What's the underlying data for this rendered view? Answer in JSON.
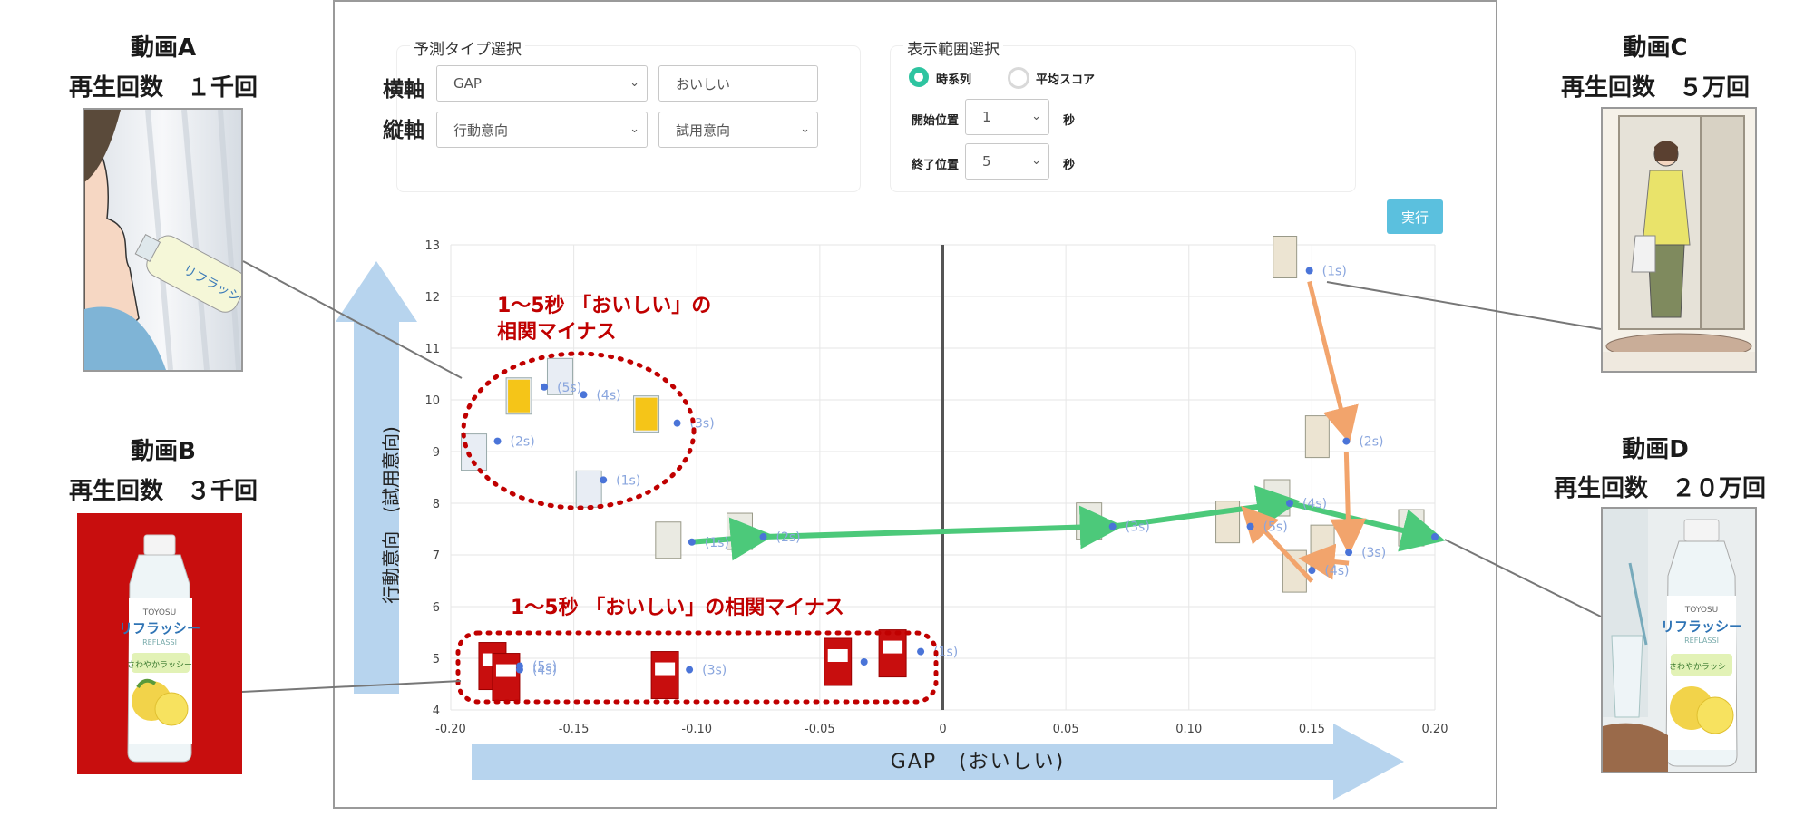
{
  "videos": {
    "a": {
      "title": "動画A",
      "plays": "再生回数　１千回"
    },
    "b": {
      "title": "動画B",
      "plays": "再生回数　３千回"
    },
    "c": {
      "title": "動画C",
      "plays": "再生回数　５万回"
    },
    "d": {
      "title": "動画D",
      "plays": "再生回数　２０万回"
    }
  },
  "form": {
    "predict_title": "予測タイプ選択",
    "x_label": "横軸",
    "y_label": "縦軸",
    "x_select": "GAP",
    "x_sub_select": "おいしい",
    "y_select": "行動意向",
    "y_sub_select": "試用意向",
    "range_title": "表示範囲選択",
    "radio_timeseries": "時系列",
    "radio_avg": "平均スコア",
    "start_label": "開始位置",
    "start_value": "1",
    "end_label": "終了位置",
    "end_value": "5",
    "unit_sec": "秒",
    "run_button": "実行"
  },
  "annotations": {
    "upper_line1": "1〜5秒 「おいしい」の",
    "upper_line2": "相関マイナス",
    "lower": "1〜5秒 「おいしい」の相関マイナス"
  },
  "colors": {
    "point": "#4a74d8",
    "point_label": "#8aa6de",
    "green_arrow": "#4cc97a",
    "orange_arrow": "#f2a46c",
    "annotation_red": "#c00000",
    "axis_arrow": "#b7d4ee",
    "bottle_red": "#c80e0e"
  },
  "chart_data": {
    "type": "scatter",
    "xlabel": "GAP　(おいしい)",
    "ylabel": "行動意向　(試用意向)",
    "xlim": [
      -0.2,
      0.2
    ],
    "ylim": [
      4,
      13
    ],
    "xticks": [
      -0.2,
      -0.15,
      -0.1,
      -0.05,
      0,
      0.05,
      0.1,
      0.15,
      0.2
    ],
    "xtick_labels": [
      "-0.20",
      "-0.15",
      "-0.10",
      "-0.05",
      "0",
      "0.05",
      "0.10",
      "0.15",
      "0.20"
    ],
    "yticks": [
      4,
      5,
      6,
      7,
      8,
      9,
      10,
      11,
      12,
      13
    ],
    "ytick_labels": [
      "4",
      "5",
      "6",
      "7",
      "8",
      "9",
      "10",
      "11",
      "12",
      "13"
    ],
    "grid": true,
    "series": [
      {
        "name": "動画A",
        "points": [
          {
            "x": -0.138,
            "y": 8.45,
            "label": "(1s)"
          },
          {
            "x": -0.181,
            "y": 9.2,
            "label": "(2s)"
          },
          {
            "x": -0.108,
            "y": 9.55,
            "label": "(3s)"
          },
          {
            "x": -0.146,
            "y": 10.1,
            "label": "(4s)"
          },
          {
            "x": -0.162,
            "y": 10.25,
            "label": "(5s)"
          }
        ]
      },
      {
        "name": "動画B",
        "points": [
          {
            "x": -0.172,
            "y": 4.78,
            "label": "(4s)"
          },
          {
            "x": -0.172,
            "y": 4.85,
            "label": "(5s)"
          },
          {
            "x": -0.103,
            "y": 4.78,
            "label": "(3s)"
          },
          {
            "x": -0.032,
            "y": 4.93,
            "label": ""
          },
          {
            "x": -0.009,
            "y": 5.13,
            "label": "(1s)"
          }
        ]
      },
      {
        "name": "動画C",
        "points": [
          {
            "x": 0.149,
            "y": 12.5,
            "label": "(1s)"
          },
          {
            "x": 0.164,
            "y": 9.2,
            "label": "(2s)"
          },
          {
            "x": 0.165,
            "y": 7.05,
            "label": "(3s)"
          },
          {
            "x": 0.15,
            "y": 6.7,
            "label": "(4s)"
          },
          {
            "x": 0.125,
            "y": 7.55,
            "label": "(5s)"
          }
        ]
      },
      {
        "name": "動画D",
        "points": [
          {
            "x": -0.102,
            "y": 7.25,
            "label": "(1s)"
          },
          {
            "x": -0.073,
            "y": 7.35,
            "label": "(2s)"
          },
          {
            "x": 0.069,
            "y": 7.55,
            "label": "(3s)"
          },
          {
            "x": 0.141,
            "y": 8.0,
            "label": "(4s)"
          },
          {
            "x": 0.2,
            "y": 7.35,
            "label": ""
          }
        ]
      }
    ]
  }
}
